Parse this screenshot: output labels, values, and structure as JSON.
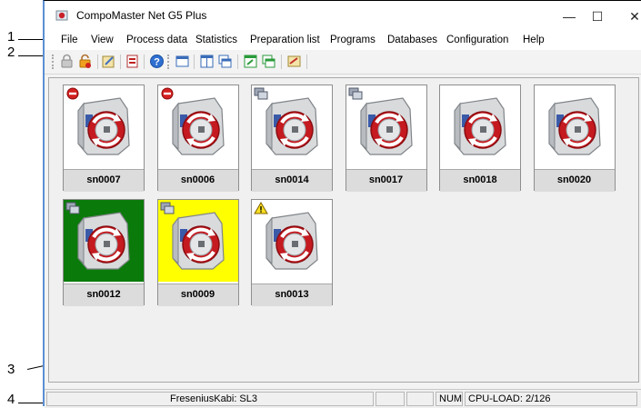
{
  "callouts": [
    "1",
    "2",
    "3",
    "4"
  ],
  "window": {
    "title": "CompoMaster Net G5 Plus",
    "controls": {
      "minimize": "—",
      "maximize": "☐",
      "close": "✕"
    }
  },
  "menu": {
    "items": [
      "File",
      "View",
      "Process data",
      "Statistics",
      "Preparation list",
      "Programs",
      "Databases",
      "Configuration",
      "Help"
    ]
  },
  "toolbar": {
    "buttons": [
      "lock-icon",
      "unlock-icon",
      "edit-icon",
      "report-icon",
      "help-icon",
      "window-icon",
      "tile-icon",
      "cascade-icon",
      "export-icon",
      "copy-icon",
      "settings-icon"
    ]
  },
  "devices": [
    {
      "name": "sn0007",
      "background": "#ffffff",
      "badge": "no-entry"
    },
    {
      "name": "sn0006",
      "background": "#ffffff",
      "badge": "no-entry"
    },
    {
      "name": "sn0014",
      "background": "#ffffff",
      "badge": "network"
    },
    {
      "name": "sn0017",
      "background": "#ffffff",
      "badge": "network"
    },
    {
      "name": "sn0018",
      "background": "#ffffff",
      "badge": "none"
    },
    {
      "name": "sn0020",
      "background": "#ffffff",
      "badge": "none"
    },
    {
      "name": "sn0012",
      "background": "#0a7a0a",
      "badge": "network"
    },
    {
      "name": "sn0009",
      "background": "#ffff00",
      "badge": "network"
    },
    {
      "name": "sn0013",
      "background": "#ffffff",
      "badge": "warning"
    }
  ],
  "status": {
    "user": "FreseniusKabi: SL3",
    "num": "NUM",
    "cpu": "CPU-LOAD: 2/126"
  }
}
